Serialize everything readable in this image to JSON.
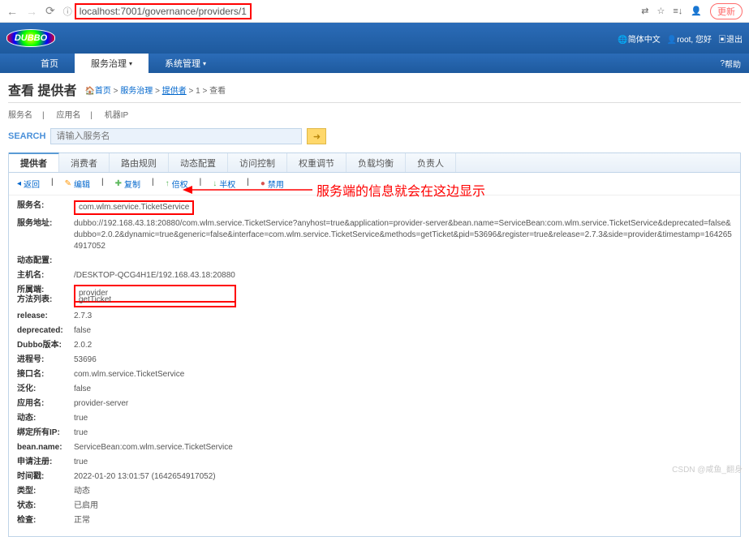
{
  "browser": {
    "url": "localhost:7001/governance/providers/1",
    "update_btn": "更新"
  },
  "banner": {
    "logo": "DUBBO",
    "lang": "简体中文",
    "user_prefix": "root, 您好",
    "logout": "退出"
  },
  "nav": {
    "home": "首页",
    "service": "服务治理",
    "system": "系统管理",
    "help": "帮助"
  },
  "header": {
    "title": "查看 提供者",
    "crumb_home": "首页",
    "crumb_gov": "服务治理",
    "crumb_prov": "提供者",
    "crumb_id": "1",
    "crumb_view": "查看"
  },
  "filters": {
    "service": "服务名",
    "app": "应用名",
    "ip": "机器IP"
  },
  "search": {
    "label": "SEARCH",
    "placeholder": "请输入服务名"
  },
  "tabs": [
    "提供者",
    "消费者",
    "路由规则",
    "动态配置",
    "访问控制",
    "权重调节",
    "负载均衡",
    "负责人"
  ],
  "actions": {
    "back": "返回",
    "edit": "编辑",
    "copy": "复制",
    "reclaim": "倍权",
    "half": "半权",
    "disable": "禁用"
  },
  "details": {
    "service_name_label": "服务名:",
    "service_name": "com.wlm.service.TicketService",
    "service_url_label": "服务地址:",
    "service_url": "dubbo://192.168.43.18:20880/com.wlm.service.TicketService?anyhost=true&application=provider-server&bean.name=ServiceBean:com.wlm.service.TicketService&deprecated=false&dubbo=2.0.2&dynamic=true&generic=false&interface=com.wlm.service.TicketService&methods=getTicket&pid=53696&register=true&release=2.7.3&side=provider&timestamp=1642654917052",
    "dyn_cfg_label": "动态配置:",
    "host_label": "主机名:",
    "host": "/DESKTOP-QCG4H1E/192.168.43.18:20880",
    "owner_label": "所属端:",
    "owner": "provider",
    "methods_label": "方法列表:",
    "methods": "getTicket",
    "release_label": "release:",
    "release": "2.7.3",
    "deprecated_label": "deprecated:",
    "deprecated": "false",
    "dubbo_label": "Dubbo版本:",
    "dubbo": "2.0.2",
    "pid_label": "进程号:",
    "pid": "53696",
    "interface_label": "接口名:",
    "interface": "com.wlm.service.TicketService",
    "generic_label": "泛化:",
    "generic": "false",
    "app_label": "应用名:",
    "app": "provider-server",
    "dynamic_label": "动态:",
    "dynamic": "true",
    "bindip_label": "绑定所有IP:",
    "bindip": "true",
    "bean_label": "bean.name:",
    "bean": "ServiceBean:com.wlm.service.TicketService",
    "register_label": "申请注册:",
    "register": "true",
    "time_label": "时间戳:",
    "time": "2022-01-20 13:01:57 (1642654917052)",
    "type_label": "类型:",
    "type": "动态",
    "status_label": "状态:",
    "status": "已启用",
    "check_label": "检查:",
    "check": "正常"
  },
  "annotation": "服务端的信息就会在这边显示",
  "watermark": "CSDN @咸鱼_翻身"
}
